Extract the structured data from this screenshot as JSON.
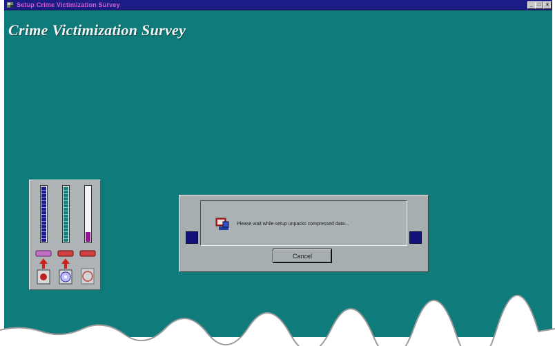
{
  "window": {
    "title": "Setup Crime Victimization Survey",
    "controls": {
      "minimize": "_",
      "maximize": "□",
      "close": "×"
    }
  },
  "heading": "Crime Victimization Survey",
  "progress_gauges": {
    "meters": [
      {
        "name": "meter-1",
        "fill_fraction": 1.0,
        "color": "#1a1a8a"
      },
      {
        "name": "meter-2",
        "fill_fraction": 1.0,
        "color": "#177f7f"
      },
      {
        "name": "meter-3",
        "fill_fraction": 0.2,
        "color": "#8a1a8a"
      }
    ],
    "icons": [
      "floppy-to-disk-icon",
      "cd-to-disk-icon",
      "disk-icon"
    ]
  },
  "dialog": {
    "message": "Please wait while setup unpacks compressed data...",
    "cancel_label": "Cancel",
    "icon": "setup-computer-icon"
  },
  "colors": {
    "titlebar": "#1c1c86",
    "title_text": "#d060d0",
    "desktop": "#0f7b7b",
    "dialog": "#a6aeb0"
  }
}
